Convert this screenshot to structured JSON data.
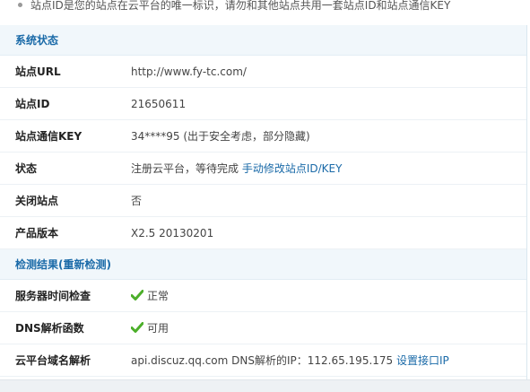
{
  "tip": {
    "text": "站点ID是您的站点在云平台的唯一标识，请勿和其他站点共用一套站点ID和站点通信KEY"
  },
  "system_status": {
    "title": "系统状态",
    "rows": [
      {
        "label": "站点URL",
        "value": "http://www.fy-tc.com/"
      },
      {
        "label": "站点ID",
        "value": "21650611"
      },
      {
        "label": "站点通信KEY",
        "value": "34****95 (出于安全考虑，部分隐藏)"
      },
      {
        "label": "状态",
        "value": "注册云平台，等待完成 ",
        "link": "手动修改站点ID/KEY"
      },
      {
        "label": "关闭站点",
        "value": "否"
      },
      {
        "label": "产品版本",
        "value": "X2.5 20130201"
      }
    ]
  },
  "check_results": {
    "title": "检测结果(重新检测)",
    "rows": [
      {
        "label": "服务器时间检查",
        "icon": "check-icon",
        "value": "正常"
      },
      {
        "label": "DNS解析函数",
        "icon": "check-icon",
        "value": "可用"
      },
      {
        "label": "云平台域名解析",
        "value": "api.discuz.qq.com DNS解析的IP：112.65.195.175 ",
        "link": "设置接口IP"
      }
    ]
  },
  "colors": {
    "accent": "#1a6aa8",
    "section_bg": "#f1f7fb",
    "check": "#4caf2a"
  }
}
